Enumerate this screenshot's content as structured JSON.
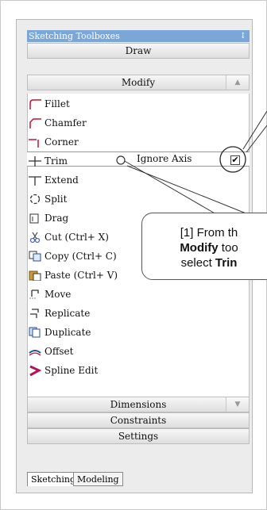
{
  "panel_title": "Sketching Toolboxes",
  "pin_icon": "pin-icon",
  "categories": {
    "draw": "Draw",
    "modify": "Modify",
    "dimensions": "Dimensions",
    "constraints": "Constraints",
    "settings": "Settings"
  },
  "tools": [
    {
      "label": "Fillet",
      "icon": "fillet-icon"
    },
    {
      "label": "Chamfer",
      "icon": "chamfer-icon"
    },
    {
      "label": "Corner",
      "icon": "corner-icon"
    },
    {
      "label": "Trim",
      "icon": "trim-icon"
    },
    {
      "label": "Extend",
      "icon": "extend-icon"
    },
    {
      "label": "Split",
      "icon": "split-icon"
    },
    {
      "label": "Drag",
      "icon": "drag-icon"
    },
    {
      "label": "Cut (Ctrl+ X)",
      "icon": "cut-icon"
    },
    {
      "label": "Copy (Ctrl+ C)",
      "icon": "copy-icon"
    },
    {
      "label": "Paste (Ctrl+ V)",
      "icon": "paste-icon"
    },
    {
      "label": "Move",
      "icon": "move-icon"
    },
    {
      "label": "Replicate",
      "icon": "replicate-icon"
    },
    {
      "label": "Duplicate",
      "icon": "duplicate-icon"
    },
    {
      "label": "Offset",
      "icon": "offset-icon"
    },
    {
      "label": "Spline Edit",
      "icon": "spline-edit-icon"
    }
  ],
  "trim_option": {
    "label": "Ignore Axis",
    "checked": true
  },
  "tabs": [
    "Sketching",
    "Modeling"
  ],
  "callout": {
    "prefix": "[1] From th",
    "modify": "Modify",
    "middle": " too",
    "select": "select ",
    "trim": "Trin"
  },
  "colors": {
    "title_bar": "#7aa6d8",
    "icon_red": "#c8102e"
  }
}
